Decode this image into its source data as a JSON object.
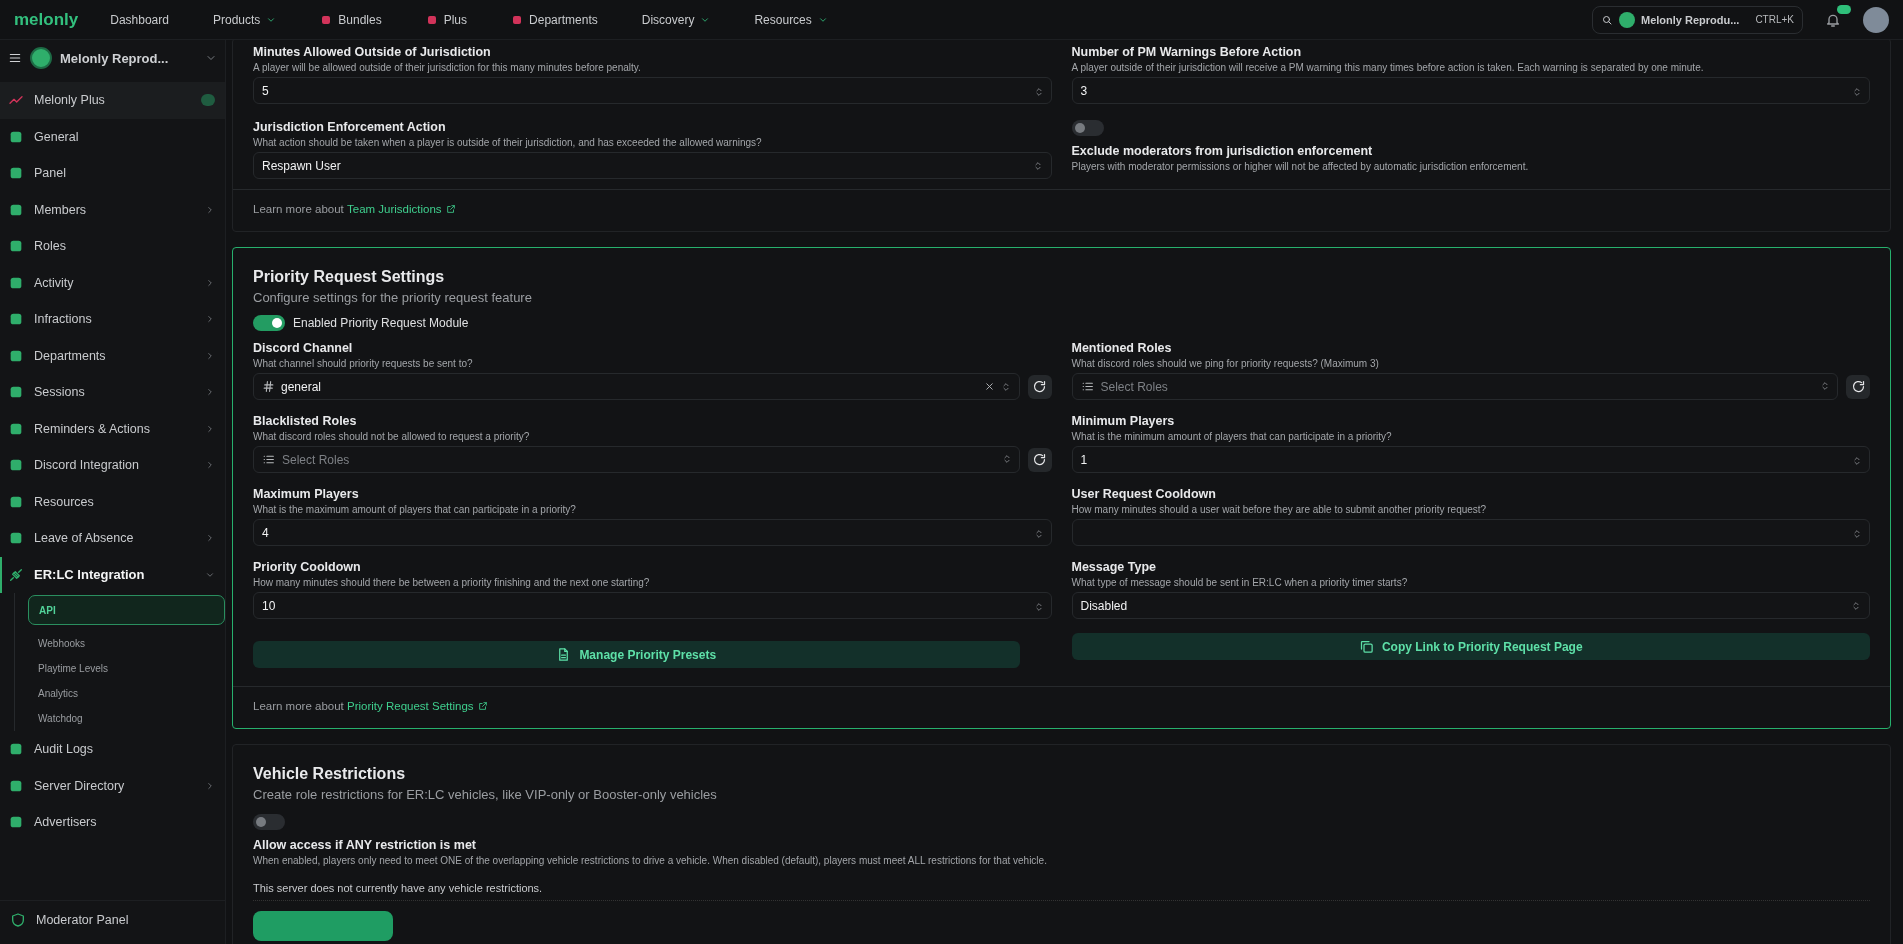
{
  "top_nav": {
    "logo": "melonly",
    "links": [
      {
        "label": "Dashboard",
        "kind": "plain",
        "dropdown": false
      },
      {
        "label": "Products",
        "kind": "plain",
        "dropdown": true
      },
      {
        "label": "Bundles",
        "kind": "icon",
        "dropdown": false
      },
      {
        "label": "Plus",
        "kind": "icon",
        "dropdown": false
      },
      {
        "label": "Departments",
        "kind": "icon",
        "dropdown": false
      },
      {
        "label": "Discovery",
        "kind": "plain",
        "dropdown": true
      },
      {
        "label": "Resources",
        "kind": "plain",
        "dropdown": true
      }
    ],
    "server_switcher": {
      "name": "Melonly Reprodu...",
      "shortcut": "CTRL+K"
    }
  },
  "sidebar": {
    "server_name": "Melonly Reprod...",
    "items": [
      {
        "label": "Melonly Plus",
        "kind": "plus",
        "expandable": false,
        "expanded": false,
        "selected": false
      },
      {
        "label": "General",
        "kind": "item",
        "expandable": false,
        "expanded": false,
        "selected": false
      },
      {
        "label": "Panel",
        "kind": "item",
        "expandable": false,
        "expanded": false,
        "selected": false
      },
      {
        "label": "Members",
        "kind": "item",
        "expandable": true,
        "expanded": false,
        "selected": false
      },
      {
        "label": "Roles",
        "kind": "item",
        "expandable": false,
        "expanded": false,
        "selected": false
      },
      {
        "label": "Activity",
        "kind": "item",
        "expandable": true,
        "expanded": false,
        "selected": false
      },
      {
        "label": "Infractions",
        "kind": "item",
        "expandable": true,
        "expanded": false,
        "selected": false
      },
      {
        "label": "Departments",
        "kind": "item",
        "expandable": true,
        "expanded": false,
        "selected": false
      },
      {
        "label": "Sessions",
        "kind": "item",
        "expandable": true,
        "expanded": false,
        "selected": false
      },
      {
        "label": "Reminders & Actions",
        "kind": "item",
        "expandable": true,
        "expanded": false,
        "selected": false
      },
      {
        "label": "Discord Integration",
        "kind": "item",
        "expandable": true,
        "expanded": false,
        "selected": false
      },
      {
        "label": "Resources",
        "kind": "item",
        "expandable": false,
        "expanded": false,
        "selected": false
      },
      {
        "label": "Leave of Absence",
        "kind": "item",
        "expandable": true,
        "expanded": false,
        "selected": false
      },
      {
        "label": "ER:LC Integration",
        "kind": "item",
        "expandable": true,
        "expanded": true,
        "selected": false,
        "children": [
          {
            "label": "API",
            "selected": true
          },
          {
            "label": "Webhooks",
            "selected": false
          },
          {
            "label": "Playtime Levels",
            "selected": false
          },
          {
            "label": "Analytics",
            "selected": false
          },
          {
            "label": "Watchdog",
            "selected": false
          }
        ]
      },
      {
        "label": "Audit Logs",
        "kind": "item",
        "expandable": false,
        "expanded": false,
        "selected": false
      },
      {
        "label": "Server Directory",
        "kind": "item",
        "expandable": true,
        "expanded": false,
        "selected": false
      },
      {
        "label": "Advertisers",
        "kind": "item",
        "expandable": false,
        "expanded": false,
        "selected": false
      }
    ],
    "footer": {
      "label": "Moderator Panel"
    }
  },
  "sections": [
    {
      "kind": "jurisdiction",
      "highlighted": false,
      "fields": [
        {
          "kind": "number",
          "label": "Minutes Allowed Outside of Jurisdiction",
          "description": "A player will be allowed outside of their jurisdiction for this many minutes before penalty.",
          "value": "5"
        },
        {
          "kind": "number",
          "label": "Number of PM Warnings Before Action",
          "description": "A player outside of their jurisdiction will receive a PM warning this many times before action is taken. Each warning is separated by one minute.",
          "value": "3"
        },
        {
          "kind": "select",
          "label": "Jurisdiction Enforcement Action",
          "description": "What action should be taken when a player is outside of their jurisdiction, and has exceeded the allowed warnings?",
          "value": "Respawn User"
        },
        {
          "kind": "toggle",
          "label": "Exclude moderators from jurisdiction enforcement",
          "description": "Players with moderator permissions or higher will not be affected by automatic jurisdiction enforcement.",
          "on": false
        }
      ],
      "footer": {
        "text": "Learn more about",
        "link": "Team Jurisdictions"
      }
    },
    {
      "kind": "priority",
      "highlighted": true,
      "title": "Priority Request Settings",
      "subtitle": "Configure settings for the priority request feature",
      "toggle": {
        "label": "Enabled Priority Request Module",
        "on": true
      },
      "fields": [
        {
          "kind": "select",
          "label": "Discord Channel",
          "description": "What channel should priority requests be sent to?",
          "value": "general",
          "channel": true,
          "clearable": true,
          "refresh": true
        },
        {
          "kind": "multiselect",
          "label": "Mentioned Roles",
          "description": "What discord roles should we ping for priority requests? (Maximum 3)",
          "placeholder": "Select Roles",
          "refresh": true
        },
        {
          "kind": "multiselect",
          "label": "Blacklisted Roles",
          "description": "What discord roles should not be allowed to request a priority?",
          "placeholder": "Select Roles",
          "refresh": true
        },
        {
          "kind": "number",
          "label": "Minimum Players",
          "description": "What is the minimum amount of players that can participate in a priority?",
          "value": "1"
        },
        {
          "kind": "number",
          "label": "Maximum Players",
          "description": "What is the maximum amount of players that can participate in a priority?",
          "value": "4"
        },
        {
          "kind": "number",
          "label": "User Request Cooldown",
          "description": "How many minutes should a user wait before they are able to submit another priority request?"
        },
        {
          "kind": "number",
          "label": "Priority Cooldown",
          "description": "How many minutes should there be between a priority finishing and the next one starting?",
          "value": "10"
        },
        {
          "kind": "select",
          "label": "Message Type",
          "description": "What type of message should be sent in ER:LC when a priority timer starts?",
          "value": "Disabled"
        }
      ],
      "buttons": [
        "Manage Priority Presets",
        "Copy Link to Priority Request Page"
      ],
      "footer": {
        "text": "Learn more about",
        "link": "Priority Request Settings"
      }
    },
    {
      "kind": "vehicles",
      "highlighted": false,
      "title": "Vehicle Restrictions",
      "subtitle": "Create role restrictions for ER:LC vehicles, like VIP-only or Booster-only vehicles",
      "fields": [
        {
          "kind": "toggle",
          "label": "Allow access if ANY restriction is met",
          "description": "When enabled, players only need to meet ONE of the overlapping vehicle restrictions to drive a vehicle. When disabled (default), players must meet ALL restrictions for that vehicle.",
          "on": false
        }
      ],
      "empty_text": "This server does not currently have any vehicle restrictions."
    }
  ]
}
